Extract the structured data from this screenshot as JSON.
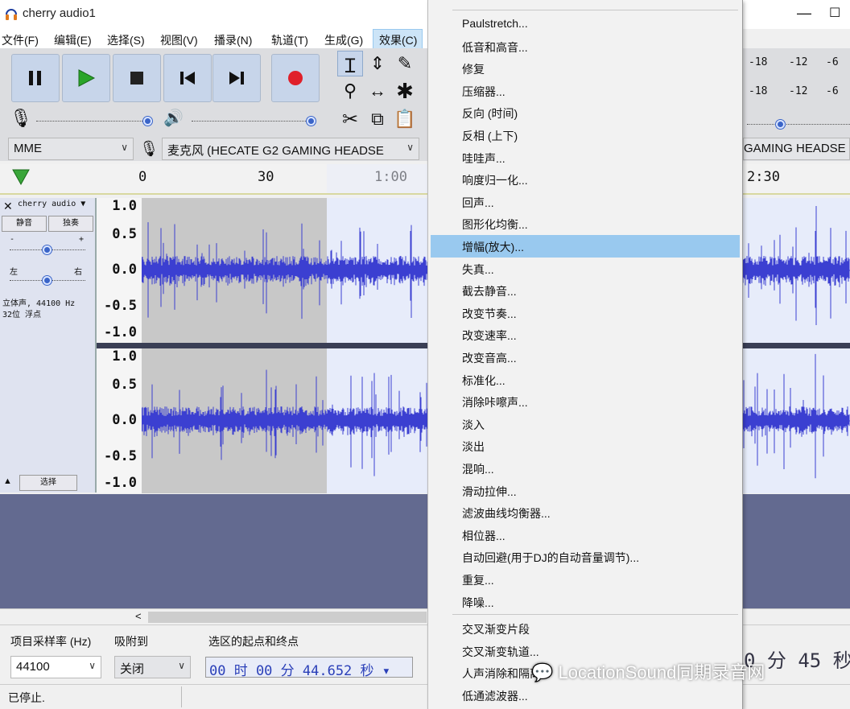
{
  "window": {
    "title": "cherry audio1"
  },
  "menubar": {
    "items": [
      {
        "label": "文件(F)"
      },
      {
        "label": "编辑(E)"
      },
      {
        "label": "选择(S)"
      },
      {
        "label": "视图(V)"
      },
      {
        "label": "播录(N)"
      },
      {
        "label": "轨道(T)"
      },
      {
        "label": "生成(G)"
      },
      {
        "label": "效果(C)"
      }
    ]
  },
  "toolbar": {
    "host": "MME",
    "input_device": "麦克风 (HECATE G2 GAMING HEADSE",
    "input_device_right": "GAMING HEADSE",
    "meter_ticks": [
      "-18",
      "-12",
      "-6"
    ]
  },
  "ruler": {
    "ticks": [
      "0",
      "30",
      "1:00",
      "2:30"
    ]
  },
  "track": {
    "name": "cherry audio",
    "mute_label": "静音",
    "solo_label": "独奏",
    "left_label": "左",
    "right_label": "右",
    "info_line1": "立体声, 44100 Hz",
    "info_line2": "32位 浮点",
    "select_label": "选择",
    "axis_ticks": [
      "1.0",
      "0.5",
      "0.0",
      "-0.5",
      "-1.0"
    ]
  },
  "selection_bar": {
    "rate_label": "项目采样率 (Hz)",
    "snap_label": "吸附到",
    "sel_label": "选区的起点和终点",
    "rate_value": "44100",
    "snap_value": "关闭",
    "start_time": "00 时 00 分 44.652 秒",
    "end_time_partial": "0 分 45 秒"
  },
  "status": {
    "text": "已停止."
  },
  "effect_menu": {
    "highlighted_index": 10,
    "group1": [
      "Paulstretch...",
      "低音和高音...",
      "修复",
      "压缩器...",
      "反向 (时间)",
      "反相 (上下)",
      "哇哇声...",
      "响度归一化...",
      "回声...",
      "图形化均衡...",
      "增幅(放大)...",
      "失真...",
      "截去静音...",
      "改变节奏...",
      "改变速率...",
      "改变音高...",
      "标准化...",
      "消除咔嚓声...",
      "淡入",
      "淡出",
      "混响...",
      "滑动拉伸...",
      "滤波曲线均衡器...",
      "相位器...",
      "自动回避(用于DJ的自动音量调节)...",
      "重复...",
      "降噪..."
    ],
    "group2": [
      "交叉渐变片段",
      "交叉渐变轨道...",
      "人声消除和隔离...",
      "低通滤波器..."
    ]
  },
  "watermark": "LocationSound同期录音网",
  "colors": {
    "waveform": "#3b3fd1",
    "selection": "#e7ecfa",
    "accent": "#99c9ef"
  }
}
